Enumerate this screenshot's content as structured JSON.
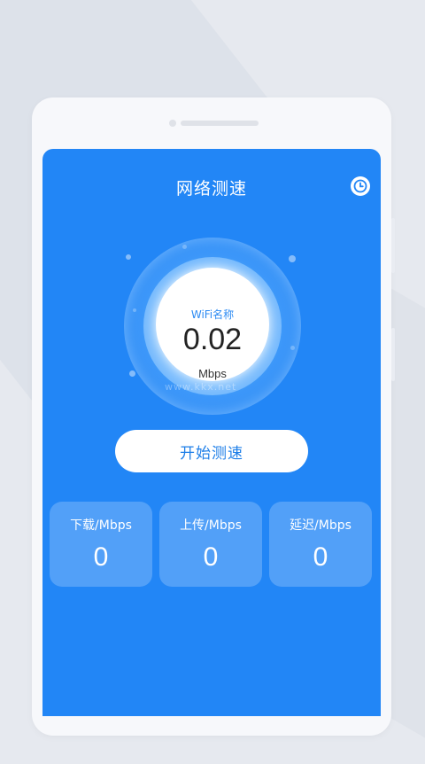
{
  "app": {
    "title": "网络测速",
    "history_icon": "clock-icon"
  },
  "gauge": {
    "wifi_name": "WiFi名称",
    "speed": "0.02",
    "unit": "Mbps"
  },
  "actions": {
    "start_label": "开始测速"
  },
  "stats": [
    {
      "label": "下载/Mbps",
      "value": "0"
    },
    {
      "label": "上传/Mbps",
      "value": "0"
    },
    {
      "label": "延迟/Mbps",
      "value": "0"
    }
  ],
  "watermark": "www.kkx.net",
  "colors": {
    "primary": "#2286f6",
    "accent_text": "#2d8bf3",
    "background": "#e6e9ef"
  }
}
